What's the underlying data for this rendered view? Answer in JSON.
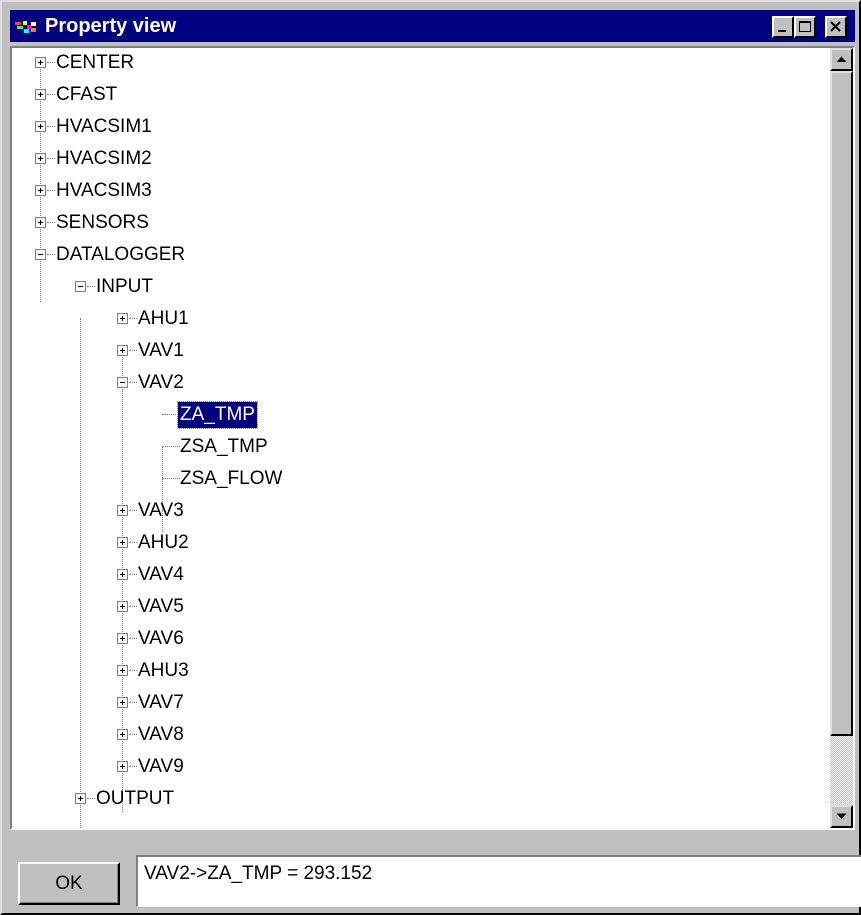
{
  "window": {
    "title": "Property view",
    "controls": [
      "minimize",
      "maximize",
      "close"
    ]
  },
  "tree": {
    "nodes": [
      {
        "label": "CENTER",
        "depth": 0,
        "state": "collapsed"
      },
      {
        "label": "CFAST",
        "depth": 0,
        "state": "collapsed"
      },
      {
        "label": "HVACSIM1",
        "depth": 0,
        "state": "collapsed"
      },
      {
        "label": "HVACSIM2",
        "depth": 0,
        "state": "collapsed"
      },
      {
        "label": "HVACSIM3",
        "depth": 0,
        "state": "collapsed"
      },
      {
        "label": "SENSORS",
        "depth": 0,
        "state": "collapsed"
      },
      {
        "label": "DATALOGGER",
        "depth": 0,
        "state": "expanded"
      },
      {
        "label": "INPUT",
        "depth": 1,
        "state": "expanded"
      },
      {
        "label": "AHU1",
        "depth": 2,
        "state": "collapsed"
      },
      {
        "label": "VAV1",
        "depth": 2,
        "state": "collapsed"
      },
      {
        "label": "VAV2",
        "depth": 2,
        "state": "expanded"
      },
      {
        "label": "ZA_TMP",
        "depth": 3,
        "state": "leaf",
        "selected": true
      },
      {
        "label": "ZSA_TMP",
        "depth": 3,
        "state": "leaf"
      },
      {
        "label": "ZSA_FLOW",
        "depth": 3,
        "state": "leaf"
      },
      {
        "label": "VAV3",
        "depth": 2,
        "state": "collapsed"
      },
      {
        "label": "AHU2",
        "depth": 2,
        "state": "collapsed"
      },
      {
        "label": "VAV4",
        "depth": 2,
        "state": "collapsed"
      },
      {
        "label": "VAV5",
        "depth": 2,
        "state": "collapsed"
      },
      {
        "label": "VAV6",
        "depth": 2,
        "state": "collapsed"
      },
      {
        "label": "AHU3",
        "depth": 2,
        "state": "collapsed"
      },
      {
        "label": "VAV7",
        "depth": 2,
        "state": "collapsed"
      },
      {
        "label": "VAV8",
        "depth": 2,
        "state": "collapsed"
      },
      {
        "label": "VAV9",
        "depth": 2,
        "state": "collapsed"
      },
      {
        "label": "OUTPUT",
        "depth": 1,
        "state": "collapsed"
      }
    ]
  },
  "footer": {
    "ok_label": "OK",
    "value_text": "VAV2->ZA_TMP = 293.152"
  },
  "colors": {
    "titlebar": "#000080",
    "face": "#c0c0c0",
    "selection": "#000080"
  },
  "icons": [
    "app-icon",
    "minimize-icon",
    "maximize-icon",
    "close-icon",
    "scroll-up-arrow-icon",
    "scroll-down-arrow-icon"
  ]
}
